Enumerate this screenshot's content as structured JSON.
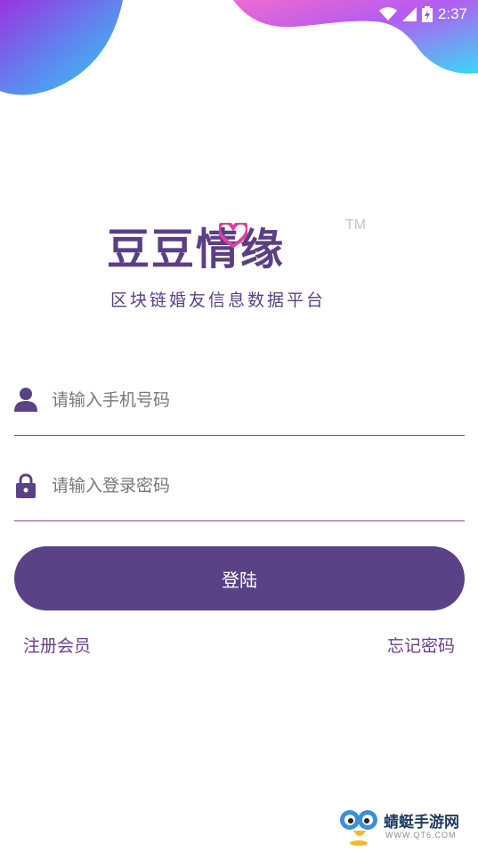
{
  "status_bar": {
    "time": "2:37"
  },
  "logo": {
    "title": "豆豆情缘",
    "trademark": "TM",
    "subtitle": "区块链婚友信息数据平台"
  },
  "form": {
    "phone_placeholder": "请输入手机号码",
    "password_placeholder": "请输入登录密码",
    "login_label": "登陆"
  },
  "links": {
    "register": "注册会员",
    "forgot_password": "忘记密码"
  },
  "watermark": {
    "name": "蜻蜓手游网",
    "url": "WWW.QT6.COM"
  },
  "colors": {
    "primary": "#5b4287",
    "accent_pink": "#e040a0",
    "accent_cyan": "#2ed0f0"
  }
}
